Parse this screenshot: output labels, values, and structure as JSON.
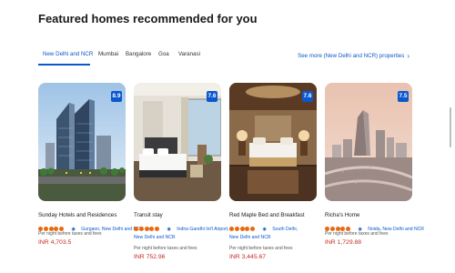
{
  "section": {
    "title": "Featured homes recommended for you"
  },
  "tabs": [
    {
      "label": "New Delhi and NCR",
      "active": true
    },
    {
      "label": "Mumbai",
      "active": false
    },
    {
      "label": "Bangalore",
      "active": false
    },
    {
      "label": "Goa",
      "active": false
    },
    {
      "label": "Varanasi",
      "active": false
    }
  ],
  "see_more": {
    "label": "See more (New Delhi and NCR) properties",
    "icon": "chevron-right-icon"
  },
  "cards": [
    {
      "name": "Sunday Hotels and Residences",
      "score": "8.9",
      "rating_dots": 5,
      "location": "Gurgaon, New Delhi and NCR",
      "location_line2": "",
      "note": "Per night before taxes and fees",
      "price": "INR 4,703.5"
    },
    {
      "name": "Transit stay",
      "score": "7.6",
      "rating_dots": 5,
      "location": "Indira Gandhi Int'l Airport,",
      "location_line2": "New Delhi and NCR",
      "note": "Per night before taxes and fees",
      "price": "INR 752.96"
    },
    {
      "name": "Red Maple Bed and Breakfast",
      "score": "7.6",
      "rating_dots": 5,
      "location": "South Delhi,",
      "location_line2": "New Delhi and NCR",
      "note": "Per night before taxes and fees",
      "price": "INR 3,445.67"
    },
    {
      "name": "Richa's Home",
      "score": "7.5",
      "rating_dots": 5,
      "location": "Noida, New Delhi and NCR",
      "location_line2": "",
      "note": "Per night before taxes and fees",
      "price": "INR 1,729.88"
    }
  ],
  "colors": {
    "accent": "#0a58ca",
    "score_bg": "#0b57d0",
    "rating_dot": "#e8690f",
    "price": "#c62828"
  }
}
